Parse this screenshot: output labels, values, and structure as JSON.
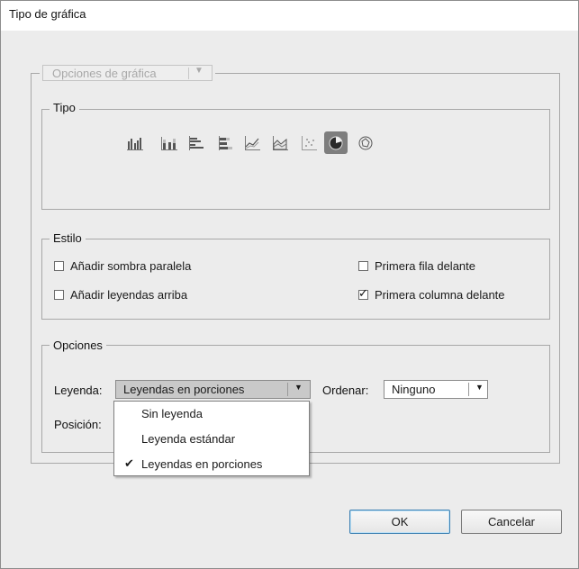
{
  "window": {
    "title": "Tipo de gráfica"
  },
  "options_selector": {
    "value": "Opciones de gráfica"
  },
  "tipo": {
    "legend": "Tipo",
    "chart_types": [
      {
        "icon": "grouped-column-icon",
        "selected": false
      },
      {
        "icon": "stacked-column-icon",
        "selected": false
      },
      {
        "icon": "grouped-bar-icon",
        "selected": false
      },
      {
        "icon": "stacked-bar-icon",
        "selected": false
      },
      {
        "icon": "line-chart-icon",
        "selected": false
      },
      {
        "icon": "area-chart-icon",
        "selected": false
      },
      {
        "icon": "scatter-chart-icon",
        "selected": false
      },
      {
        "icon": "pie-chart-icon",
        "selected": true
      },
      {
        "icon": "radar-chart-icon",
        "selected": false
      }
    ]
  },
  "estilo": {
    "legend": "Estilo",
    "add_drop_shadow": {
      "label": "Añadir sombra paralela",
      "checked": false
    },
    "add_legend_top": {
      "label": "Añadir leyendas arriba",
      "checked": false
    },
    "first_row_front": {
      "label": "Primera fila delante",
      "checked": false
    },
    "first_column_front": {
      "label": "Primera columna delante",
      "checked": true
    }
  },
  "opciones": {
    "legend": "Opciones",
    "leyenda_label": "Leyenda:",
    "leyenda_value": "Leyendas en porciones",
    "ordenar_label": "Ordenar:",
    "ordenar_value": "Ninguno",
    "posicion_label": "Posición:",
    "leyenda_options": [
      {
        "label": "Sin leyenda",
        "checked": false
      },
      {
        "label": "Leyenda estándar",
        "checked": false
      },
      {
        "label": "Leyendas en porciones",
        "checked": true
      }
    ],
    "check_mark": "✔"
  },
  "buttons": {
    "ok": "OK",
    "cancel": "Cancelar"
  },
  "colors": {
    "dialog_bg": "#ececec",
    "selected_icon_bg": "#7e7e7e",
    "default_button_border": "#3c7fb1"
  }
}
